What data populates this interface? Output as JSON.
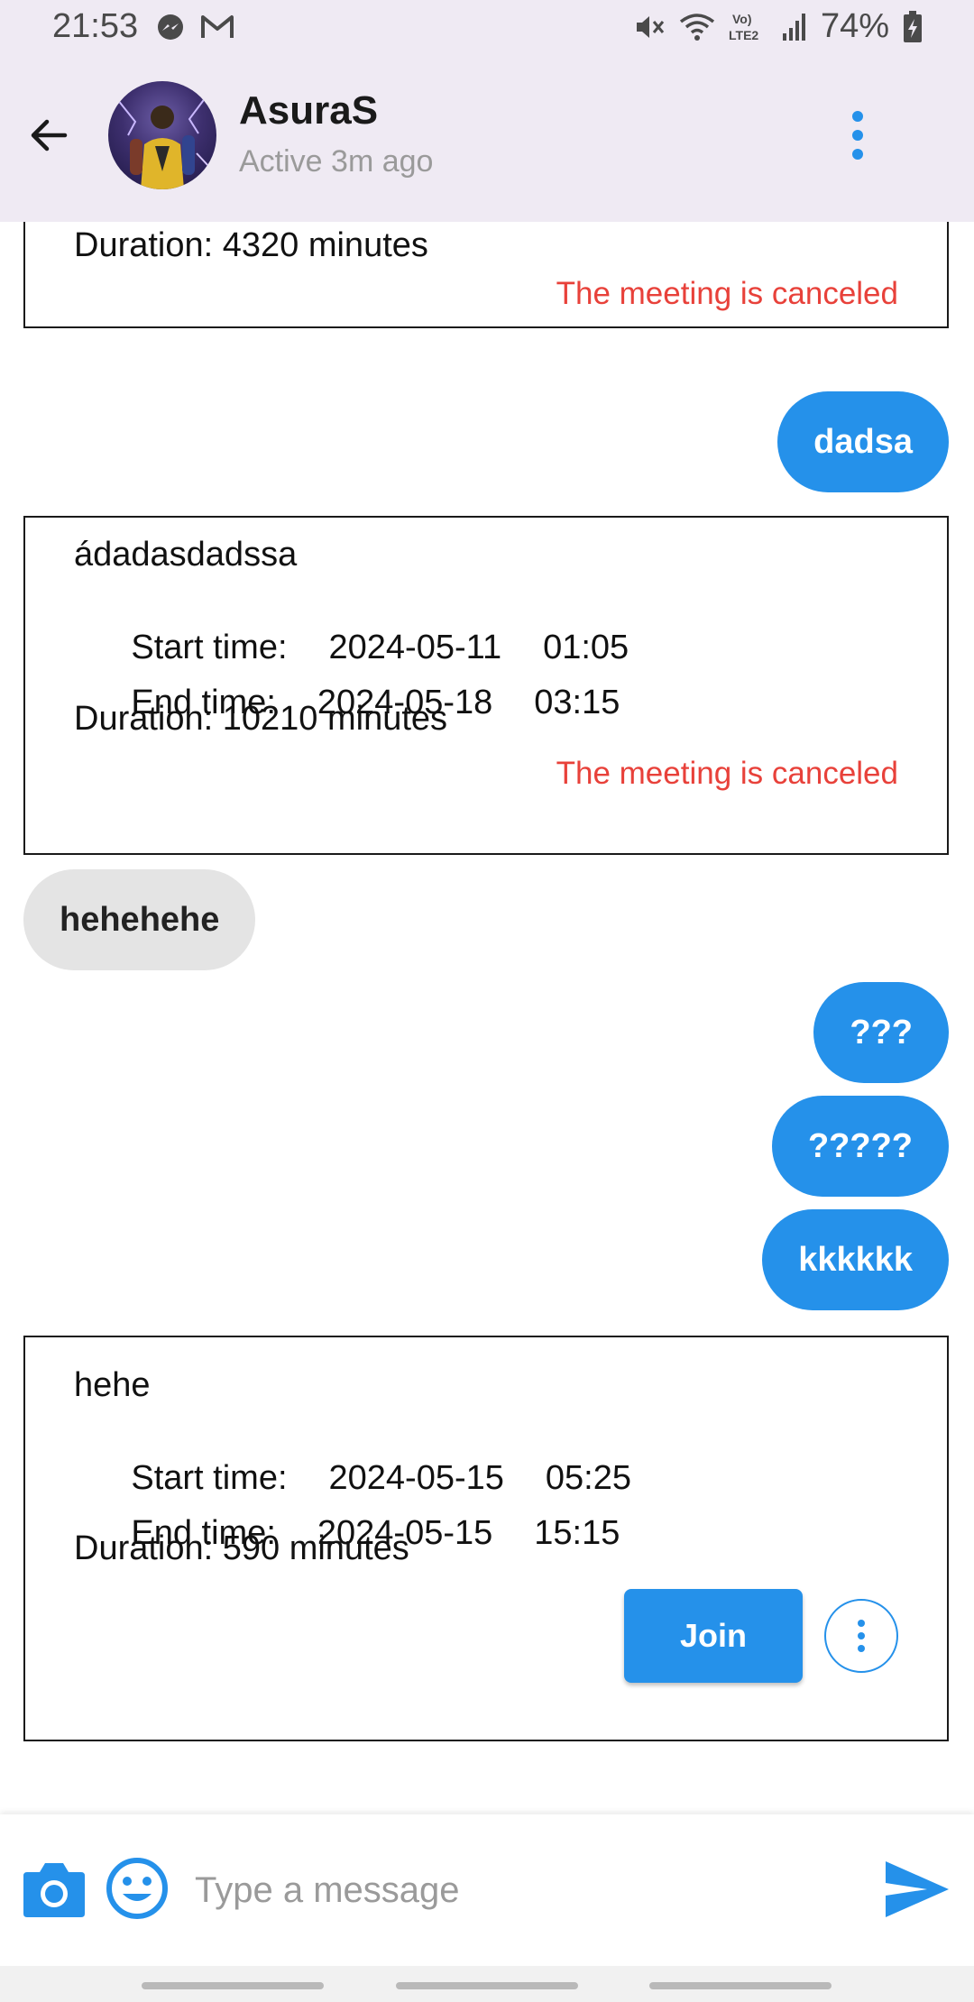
{
  "status_bar": {
    "time": "21:53",
    "battery": "74%",
    "icons": [
      "messenger-icon",
      "gmail-icon",
      "mute-icon",
      "wifi-icon",
      "volte-lte2-icon",
      "signal-icon",
      "battery-charging-icon"
    ]
  },
  "header": {
    "contact_name": "AsuraS",
    "contact_status": "Active 3m ago",
    "icons": [
      "back-arrow-icon",
      "avatar-image",
      "more-vertical-icon"
    ]
  },
  "colors": {
    "accent": "#2591ea",
    "header_bg": "#efeaf3",
    "canceled": "#e8413a",
    "incoming_bubble": "#e4e4e4"
  },
  "messages": {
    "card1": {
      "duration": "Duration: 4320 minutes",
      "status": "The meeting is canceled"
    },
    "out1": "dadsa",
    "card2": {
      "title": "ádadasdadssa",
      "start_label": "Start time:",
      "start_date": "2024-05-11",
      "start_time": "01:05",
      "end_label": "End time:",
      "end_date": "2024-05-18",
      "end_time": "03:15",
      "duration": "Duration: 10210 minutes",
      "status": "The meeting is canceled"
    },
    "in1": "hehehehe",
    "out2": "???",
    "out3": "?????",
    "out4": "kkkkkk",
    "card3": {
      "title": "hehe",
      "start_label": "Start time:",
      "start_date": "2024-05-15",
      "start_time": "05:25",
      "end_label": "End time:",
      "end_date": "2024-05-15",
      "end_time": "15:15",
      "duration": "Duration: 590 minutes",
      "join_label": "Join"
    }
  },
  "input_bar": {
    "placeholder": "Type a message",
    "value": "",
    "icons": [
      "camera-icon",
      "emoji-icon",
      "send-icon"
    ]
  }
}
